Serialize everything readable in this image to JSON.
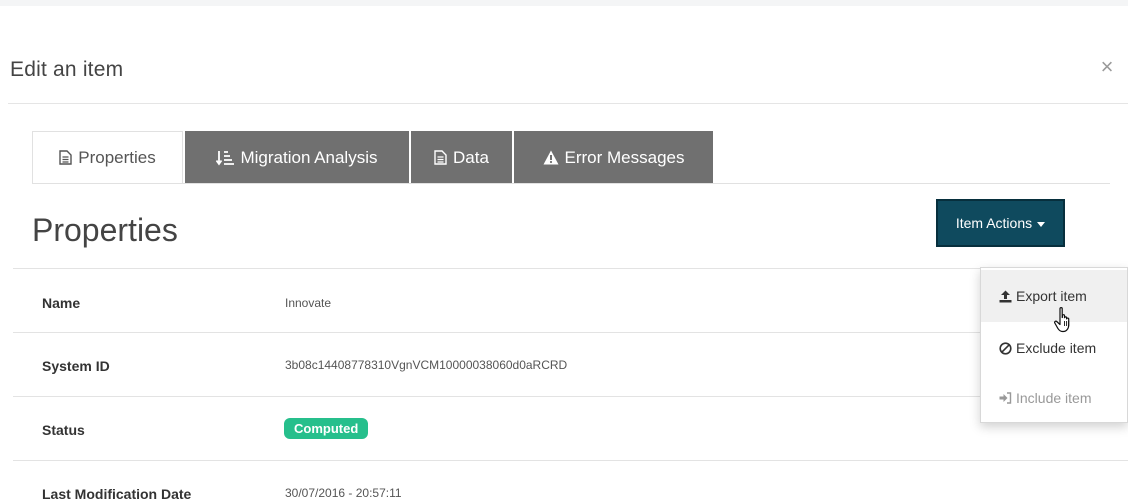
{
  "modal": {
    "title": "Edit an item",
    "close_glyph": "×"
  },
  "tabs": [
    {
      "label": "Properties",
      "icon": "file-text-icon",
      "active": true
    },
    {
      "label": "Migration Analysis",
      "icon": "sort-amount-icon",
      "active": false
    },
    {
      "label": "Data",
      "icon": "file-text-icon",
      "active": false
    },
    {
      "label": "Error Messages",
      "icon": "warning-icon",
      "active": false
    }
  ],
  "section": {
    "title": "Properties",
    "actions_label": "Item Actions"
  },
  "properties": [
    {
      "label": "Name",
      "value": "Innovate"
    },
    {
      "label": "System ID",
      "value": "3b08c14408778310VgnVCM10000038060d0aRCRD"
    },
    {
      "label": "Status",
      "value": "Computed"
    },
    {
      "label": "Last Modification Date",
      "value": "30/07/2016 - 20:57:11"
    }
  ],
  "dropdown": {
    "items": [
      {
        "label": "Export item",
        "icon": "upload-icon",
        "hover": true
      },
      {
        "label": "Exclude item",
        "icon": "ban-icon"
      },
      {
        "label": "Include item",
        "icon": "sign-in-icon",
        "disabled": true
      }
    ]
  },
  "colors": {
    "accent": "#0f4a5e",
    "tab_inactive": "#707070",
    "status_badge": "#26bf8c"
  }
}
